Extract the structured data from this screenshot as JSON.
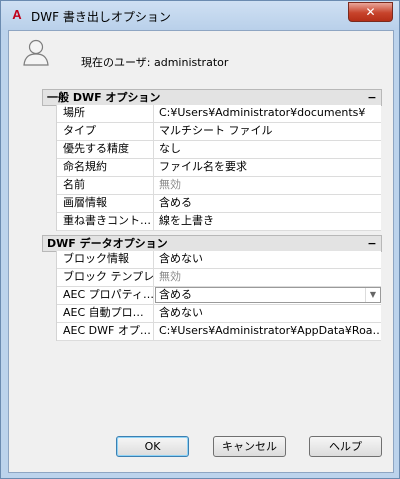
{
  "window": {
    "title": "DWF 書き出しオプション",
    "close_label": "✕",
    "app_icon_letter": "A"
  },
  "user": {
    "label": "現在のユーザ: ",
    "name": "administrator"
  },
  "sections": [
    {
      "title": "一般 DWF オプション",
      "collapse": "−",
      "rows": [
        {
          "name": "場所",
          "value": "C:¥Users¥Administrator¥documents¥",
          "disabled": false
        },
        {
          "name": "タイプ",
          "value": "マルチシート ファイル",
          "disabled": false
        },
        {
          "name": "優先する精度",
          "value": "なし",
          "disabled": false
        },
        {
          "name": "命名規約",
          "value": "ファイル名を要求",
          "disabled": false
        },
        {
          "name": "名前",
          "value": "無効",
          "disabled": true
        },
        {
          "name": "画層情報",
          "value": "含める",
          "disabled": false
        },
        {
          "name": "重ね書きコント…",
          "value": "線を上書き",
          "disabled": false
        }
      ]
    },
    {
      "title": "DWF データオプション",
      "collapse": "−",
      "rows": [
        {
          "name": "ブロック情報",
          "value": "含めない",
          "disabled": false
        },
        {
          "name": "ブロック テンプレ…",
          "value": "無効",
          "disabled": true
        },
        {
          "name": "AEC プロパティ…",
          "value": "含める",
          "disabled": false,
          "combo": true
        },
        {
          "name": "AEC 自動プロ…",
          "value": "含めない",
          "disabled": false
        },
        {
          "name": "AEC DWF オプ…",
          "value": "C:¥Users¥Administrator¥AppData¥Roa…",
          "disabled": false
        }
      ]
    }
  ],
  "buttons": {
    "ok": "OK",
    "cancel": "キャンセル",
    "help": "ヘルプ"
  }
}
